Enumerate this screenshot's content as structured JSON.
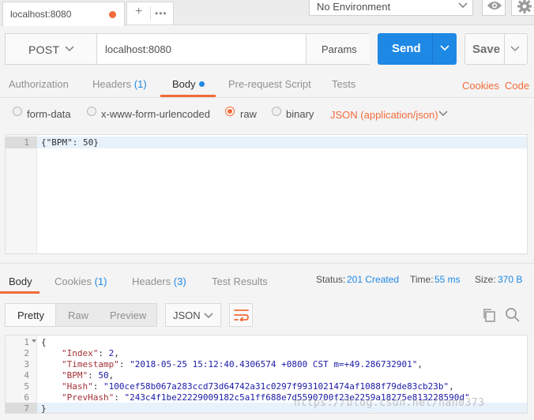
{
  "tab": {
    "title": "localhost:8080",
    "plus": "+",
    "more": "•••"
  },
  "environment": {
    "selected": "No Environment"
  },
  "request": {
    "method": "POST",
    "url": "localhost:8080",
    "params_label": "Params",
    "send_label": "Send",
    "save_label": "Save"
  },
  "request_tabs": {
    "authorization": "Authorization",
    "headers": "Headers",
    "headers_count": "(1)",
    "body": "Body",
    "prerequest": "Pre-request Script",
    "tests": "Tests",
    "cookies": "Cookies",
    "code": "Code"
  },
  "body_types": {
    "form_data": "form-data",
    "urlencoded": "x-www-form-urlencoded",
    "raw": "raw",
    "binary": "binary",
    "content_type": "JSON (application/json)",
    "selected": "raw"
  },
  "request_editor": {
    "lines": [
      {
        "num": "1",
        "text": "{\"BPM\": 50}"
      }
    ]
  },
  "response_tabs": {
    "body": "Body",
    "cookies": "Cookies",
    "cookies_count": "(1)",
    "headers": "Headers",
    "headers_count": "(3)",
    "test_results": "Test Results"
  },
  "response_meta": {
    "status_label": "Status:",
    "status_value": "201 Created",
    "time_label": "Time:",
    "time_value": "55 ms",
    "size_label": "Size:",
    "size_value": "370 B"
  },
  "response_toolbar": {
    "pretty": "Pretty",
    "raw": "Raw",
    "preview": "Preview",
    "format": "JSON"
  },
  "response_editor": {
    "line_numbers": [
      "1",
      "2",
      "3",
      "4",
      "5",
      "6",
      "7"
    ],
    "open_brace": "{",
    "close_brace": "}",
    "fields": [
      {
        "key": "\"Index\"",
        "value": "2",
        "type": "number"
      },
      {
        "key": "\"Timestamp\"",
        "value": "\"2018-05-25 15:12:40.4306574 +0800 CST m=+49.286732901\"",
        "type": "string"
      },
      {
        "key": "\"BPM\"",
        "value": "50",
        "type": "number"
      },
      {
        "key": "\"Hash\"",
        "value": "\"100cef58b067a283ccd73d64742a31c0297f9931021474af1088f79de83cb23b\"",
        "type": "string"
      },
      {
        "key": "\"PrevHash\"",
        "value": "\"243c4f1be22229009182c5a1ff688e7d5590700f23e2259a18275e813228590d\"",
        "type": "string"
      }
    ]
  },
  "watermark": "https://blog.csdn.net/han0373",
  "colors": {
    "accent": "#f26b3a",
    "primary": "#1e88e5"
  }
}
